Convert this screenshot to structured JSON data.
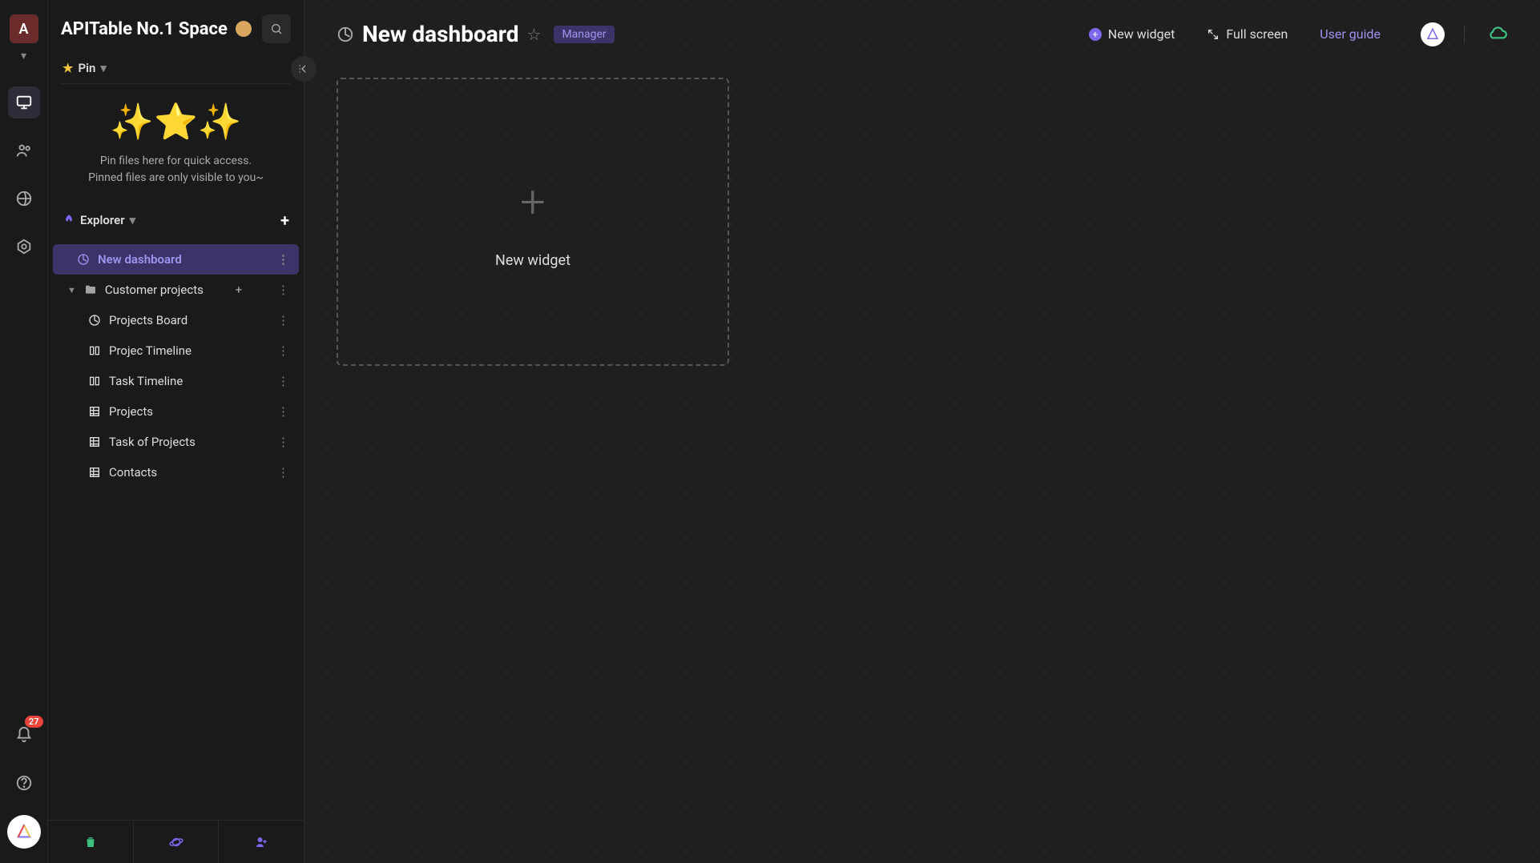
{
  "rail": {
    "avatar_letter": "A",
    "notification_count": "27"
  },
  "sidebar": {
    "workspace_title": "APITable No.1 Space",
    "pin_label": "Pin",
    "pin_empty_line1": "Pin files here for quick access.",
    "pin_empty_line2": "Pinned files are only visible to you~",
    "explorer_label": "Explorer",
    "tree": {
      "active_dashboard": "New dashboard",
      "folder_name": "Customer projects",
      "children": [
        {
          "icon": "dashboard",
          "label": "Projects Board"
        },
        {
          "icon": "timeline",
          "label": "Projec Timeline"
        },
        {
          "icon": "timeline",
          "label": "Task Timeline"
        },
        {
          "icon": "grid",
          "label": "Projects"
        },
        {
          "icon": "grid",
          "label": "Task of Projects"
        },
        {
          "icon": "grid",
          "label": "Contacts"
        }
      ]
    }
  },
  "main": {
    "title": "New dashboard",
    "role_tag": "Manager",
    "new_widget_action": "New widget",
    "fullscreen_action": "Full screen",
    "user_guide_action": "User guide",
    "placeholder_label": "New widget"
  }
}
